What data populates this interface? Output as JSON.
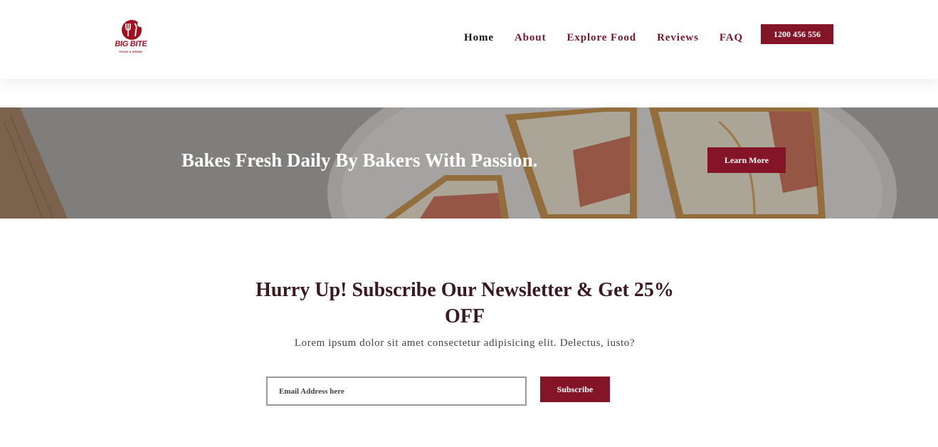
{
  "brand": {
    "name": "BIG BITE",
    "tagline": "FOOD & DRINK",
    "color": "#a01020"
  },
  "nav": {
    "items": [
      {
        "label": "Home",
        "active": true
      },
      {
        "label": "About",
        "active": false
      },
      {
        "label": "Explore Food",
        "active": false
      },
      {
        "label": "Reviews",
        "active": false
      },
      {
        "label": "FAQ",
        "active": false
      }
    ],
    "phone": "1200 456 556"
  },
  "banner": {
    "title": "Bakes Fresh Daily By Bakers With Passion.",
    "button": "Learn More"
  },
  "newsletter": {
    "title": "Hurry Up! Subscribe Our Newsletter & Get 25% OFF",
    "description": "Lorem ipsum dolor sit amet consectetur adipisicing elit. Delectus, iusto?",
    "email_placeholder": "Email Address here",
    "button": "Subscribe"
  },
  "colors": {
    "accent": "#841427",
    "heading": "#3a1a20"
  }
}
